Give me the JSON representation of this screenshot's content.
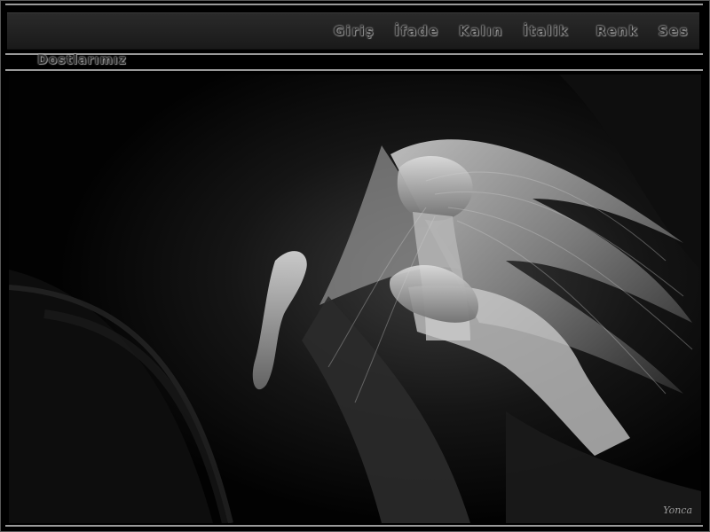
{
  "menu": {
    "items": [
      "Giriş",
      "İfade",
      "Kalın",
      "İtalik",
      "Renk",
      "Ses"
    ]
  },
  "page": {
    "title": "Dostlarımız"
  },
  "photo": {
    "subject": "woman-with-flowing-hair",
    "signature": "Yonca"
  }
}
